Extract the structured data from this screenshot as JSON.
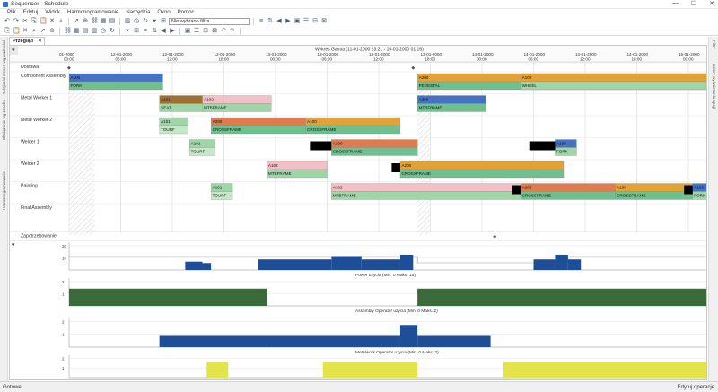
{
  "window": {
    "title": "Sequencer - Schedule",
    "controls": [
      "—",
      "☐",
      "✕"
    ]
  },
  "menu": [
    "Plik",
    "Edytuj",
    "Widok",
    "Harmonogramowanie",
    "Narzędzia",
    "Okno",
    "Pomoc"
  ],
  "toolbar": {
    "filter_placeholder": "Nie wybrano filtra",
    "row1_icons": [
      "undo-icon",
      "redo-icon",
      "cut-icon",
      "copy-icon",
      "paste-icon",
      "delete-icon",
      "find-icon",
      "pointer-icon",
      "zoom-icon",
      "link-icon",
      "schedule-icon",
      "resource-icon",
      "calendar-icon",
      "clock-icon",
      "refresh-icon",
      "filter-icon",
      "add-filter-icon"
    ],
    "row1_tail_icons": [
      "reorder-icon",
      "sort-icon",
      "move-left-icon",
      "move-right-icon",
      "group-icon",
      "align-icon",
      "split-icon",
      "merge-icon"
    ],
    "row2_icons": [
      "print-icon",
      "preview-icon",
      "export-icon",
      "save-icon",
      "open-icon",
      "new-icon",
      "chart-icon",
      "table-icon",
      "grid-icon",
      "list-icon",
      "gantt-icon",
      "view-icon",
      "zoom-in-icon",
      "zoom-out-icon",
      "fit-icon",
      "settings-icon",
      "help-icon",
      "info-icon",
      "warn-icon",
      "check-icon",
      "cross-icon",
      "star-icon",
      "flag-icon",
      "lock-icon"
    ]
  },
  "tab": {
    "label": "Przegląd",
    "close": "✕"
  },
  "side_left": [
    "Kolejność zleceń wg ważności",
    "Obciążenie wg zasobu",
    "Harmonogramowanie"
  ],
  "side_right": [
    "Filtry",
    "Kolory wyświetlania opcji"
  ],
  "gantt": {
    "header_title": "Wykres Gantta  (11-01-2000 23:21 - 15-01-2000 01:16)",
    "ticks": [
      {
        "d": "01-2000",
        "t": "00:00"
      },
      {
        "d": "12-01-2000",
        "t": "06:00"
      },
      {
        "d": "12-01-2000",
        "t": "12:00"
      },
      {
        "d": "12-01-2000",
        "t": "18:00"
      },
      {
        "d": "13-01-2000",
        "t": "00:00"
      },
      {
        "d": "13-01-2000",
        "t": "06:00"
      },
      {
        "d": "13-01-2000",
        "t": "12:00"
      },
      {
        "d": "13-01-2000",
        "t": "18:00"
      },
      {
        "d": "14-01-2000",
        "t": "00:00"
      },
      {
        "d": "14-01-2000",
        "t": "06:00"
      },
      {
        "d": "14-01-2000",
        "t": "12:00"
      },
      {
        "d": "14-01-2000",
        "t": "18:00"
      },
      {
        "d": "15-01-2000",
        "t": "00:00"
      }
    ],
    "resources": [
      "Dostawa",
      "Component Assembly",
      "Metal Worker 1",
      "Metal Worker 2",
      "Welder 1",
      "Welder 2",
      "Painting",
      "Final Assembly"
    ],
    "demand_label": "Zapotrzebowanie",
    "tasks": [
      {
        "row": 1,
        "start": 0.0,
        "end": 10.9,
        "colors": [
          "#4472c4",
          "#6fc08e"
        ],
        "code": "A100",
        "name": "FORK"
      },
      {
        "row": 1,
        "start": 40.5,
        "end": 74.5,
        "colors": [
          "#e2a236",
          "#6fc08e"
        ],
        "code": "A200",
        "name": "PEDESTAL"
      },
      {
        "row": 1,
        "start": 52.5,
        "end": 77.5,
        "colors": [
          "#e2a236",
          "#9fd6a8"
        ],
        "code": "A102",
        "name": "WHEEL"
      },
      {
        "row": 2,
        "start": 10.5,
        "end": 15.8,
        "colors": [
          "#a07030",
          "#9fd6a8"
        ],
        "code": "A101",
        "name": "SEAT"
      },
      {
        "row": 2,
        "start": 15.5,
        "end": 23.5,
        "colors": [
          "#f4c0c8",
          "#9fd6a8"
        ],
        "code": "A102",
        "name": "MTBFRAME"
      },
      {
        "row": 2,
        "start": 40.5,
        "end": 48.5,
        "colors": [
          "#4472c4",
          "#6fc08e"
        ],
        "code": "A200",
        "name": "MTBFRAME"
      },
      {
        "row": 3,
        "start": 10.5,
        "end": 13.8,
        "colors": [
          "#9fd6a8",
          "#c6e8c8"
        ],
        "code": "A101",
        "name": "TOURF"
      },
      {
        "row": 3,
        "start": 16.5,
        "end": 27.5,
        "colors": [
          "#e07b50",
          "#6fc08e"
        ],
        "code": "A200",
        "name": "CROSSFRAME"
      },
      {
        "row": 3,
        "start": 27.5,
        "end": 38.5,
        "colors": [
          "#e2a236",
          "#6fc08e"
        ],
        "code": "A100",
        "name": "CROSSFRAME"
      },
      {
        "row": 4,
        "start": 14.0,
        "end": 17.0,
        "colors": [
          "#9fd6a8",
          "#c6e8c8"
        ],
        "code": "A101",
        "name": "TOURF"
      },
      {
        "row": 4,
        "start": 30.5,
        "end": 40.5,
        "colors": [
          "#e07b50",
          "#6fc08e"
        ],
        "code": "A200",
        "name": "CROSSFRAME"
      },
      {
        "row": 4,
        "start": 56.5,
        "end": 59.0,
        "colors": [
          "#4472c4",
          "#9fd6a8"
        ],
        "code": "A100",
        "name": "FORK"
      },
      {
        "row": 5,
        "start": 23.0,
        "end": 30.0,
        "colors": [
          "#f4c0c8",
          "#9fd6a8"
        ],
        "code": "A102",
        "name": "MTBFRAME"
      },
      {
        "row": 5,
        "start": 38.5,
        "end": 57.5,
        "colors": [
          "#e2a236",
          "#6fc08e"
        ],
        "code": "A200",
        "name": "CROSSFRAME"
      },
      {
        "row": 6,
        "start": 16.5,
        "end": 19.0,
        "colors": [
          "#9fd6a8",
          "#c6e8c8"
        ],
        "code": "A101",
        "name": "TOURF"
      },
      {
        "row": 6,
        "start": 30.5,
        "end": 52.5,
        "colors": [
          "#f4c0c8",
          "#9fd6a8"
        ],
        "code": "A102",
        "name": "MTBFRAME"
      },
      {
        "row": 6,
        "start": 52.5,
        "end": 63.5,
        "colors": [
          "#e07b50",
          "#6fc08e"
        ],
        "code": "A200",
        "name": "CROSSFRAME"
      },
      {
        "row": 6,
        "start": 63.5,
        "end": 72.5,
        "colors": [
          "#e2a236",
          "#6fc08e"
        ],
        "code": "A100",
        "name": "CROSSFRAME"
      },
      {
        "row": 6,
        "start": 72.5,
        "end": 76.5,
        "colors": [
          "#4472c4",
          "#9fd6a8"
        ],
        "code": "A100",
        "name": "FORK"
      },
      {
        "row": 7,
        "start": 78.5,
        "end": 90.5,
        "colors": [
          "#f4c0c8",
          "#9fd6a8"
        ],
        "code": "A102",
        "name": "MTBFRAME"
      },
      {
        "row": 7,
        "start": 90.5,
        "end": 102.0,
        "colors": [
          "#e2a236",
          "#6fc08e"
        ],
        "code": "A200",
        "name": "PEDESTAL"
      },
      {
        "row": 7,
        "start": 102.0,
        "end": 109.5,
        "colors": [
          "#d8a0e0",
          "#9fd6a8"
        ],
        "code": "A100",
        "name": "WHEEL"
      }
    ],
    "blocks": [
      {
        "row": 4,
        "start": 28.0,
        "end": 30.5
      },
      {
        "row": 4,
        "start": 53.5,
        "end": 56.5
      },
      {
        "row": 5,
        "start": 37.5,
        "end": 38.5
      },
      {
        "row": 6,
        "start": 51.5,
        "end": 52.5
      },
      {
        "row": 6,
        "start": 71.5,
        "end": 72.5
      }
    ],
    "graphs": [
      {
        "label": "Power użycia (Min. 0 Maks. 15)",
        "ticks": [
          "10",
          "20"
        ],
        "color": "#1f4e99",
        "bars": [
          [
            13.5,
            15.5,
            0.3
          ],
          [
            15.5,
            16.5,
            0.25
          ],
          [
            22.0,
            30.5,
            0.38
          ],
          [
            30.5,
            34.0,
            0.5
          ],
          [
            34.0,
            38.5,
            0.38
          ],
          [
            38.5,
            40.0,
            0.55
          ],
          [
            54.0,
            56.5,
            0.38
          ],
          [
            56.5,
            58.0,
            0.55
          ],
          [
            58.0,
            59.5,
            0.38
          ]
        ]
      },
      {
        "label": "Assembly Operator użycia (Min. 0 Maks. 2)",
        "ticks": [
          "1",
          "2"
        ],
        "color": "#3b6b3a",
        "bars": [
          [
            0.0,
            23.0,
            0.62
          ],
          [
            40.5,
            109.0,
            0.62
          ]
        ]
      },
      {
        "label": "Metalwork Operator użycia (Min. 0 Maks. 2)",
        "ticks": [
          "1",
          "2"
        ],
        "color": "#1f4e99",
        "bars": [
          [
            10.5,
            23.0,
            0.38
          ],
          [
            23.0,
            38.5,
            0.38
          ],
          [
            38.5,
            40.5,
            0.75
          ],
          [
            40.5,
            49.0,
            0.38
          ]
        ]
      },
      {
        "label": "",
        "ticks": [
          "1",
          "2"
        ],
        "color": "#e3e34a",
        "bars": [
          [
            16.0,
            18.5,
            0.7
          ],
          [
            29.5,
            40.5,
            0.7
          ],
          [
            50.5,
            76.5,
            0.7
          ]
        ]
      }
    ]
  },
  "status": {
    "left": "Gotowe",
    "right": "Edytuj operacje"
  }
}
